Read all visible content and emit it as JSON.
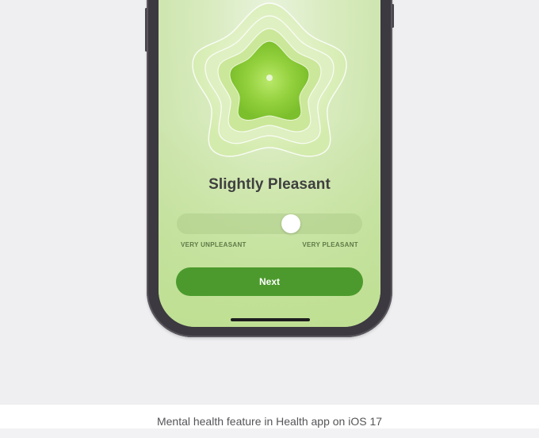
{
  "mood": {
    "title": "Slightly Pleasant",
    "slider_value": 0.63,
    "label_min": "VERY UNPLEASANT",
    "label_max": "VERY PLEASANT"
  },
  "actions": {
    "next_label": "Next"
  },
  "caption": "Mental health feature in Health app on iOS 17",
  "colors": {
    "accent_green": "#4c9a2d",
    "screen_background": "#d8ebbe",
    "page_background": "#efeff1"
  },
  "icons": {
    "mood_shape": "flower-icon"
  }
}
